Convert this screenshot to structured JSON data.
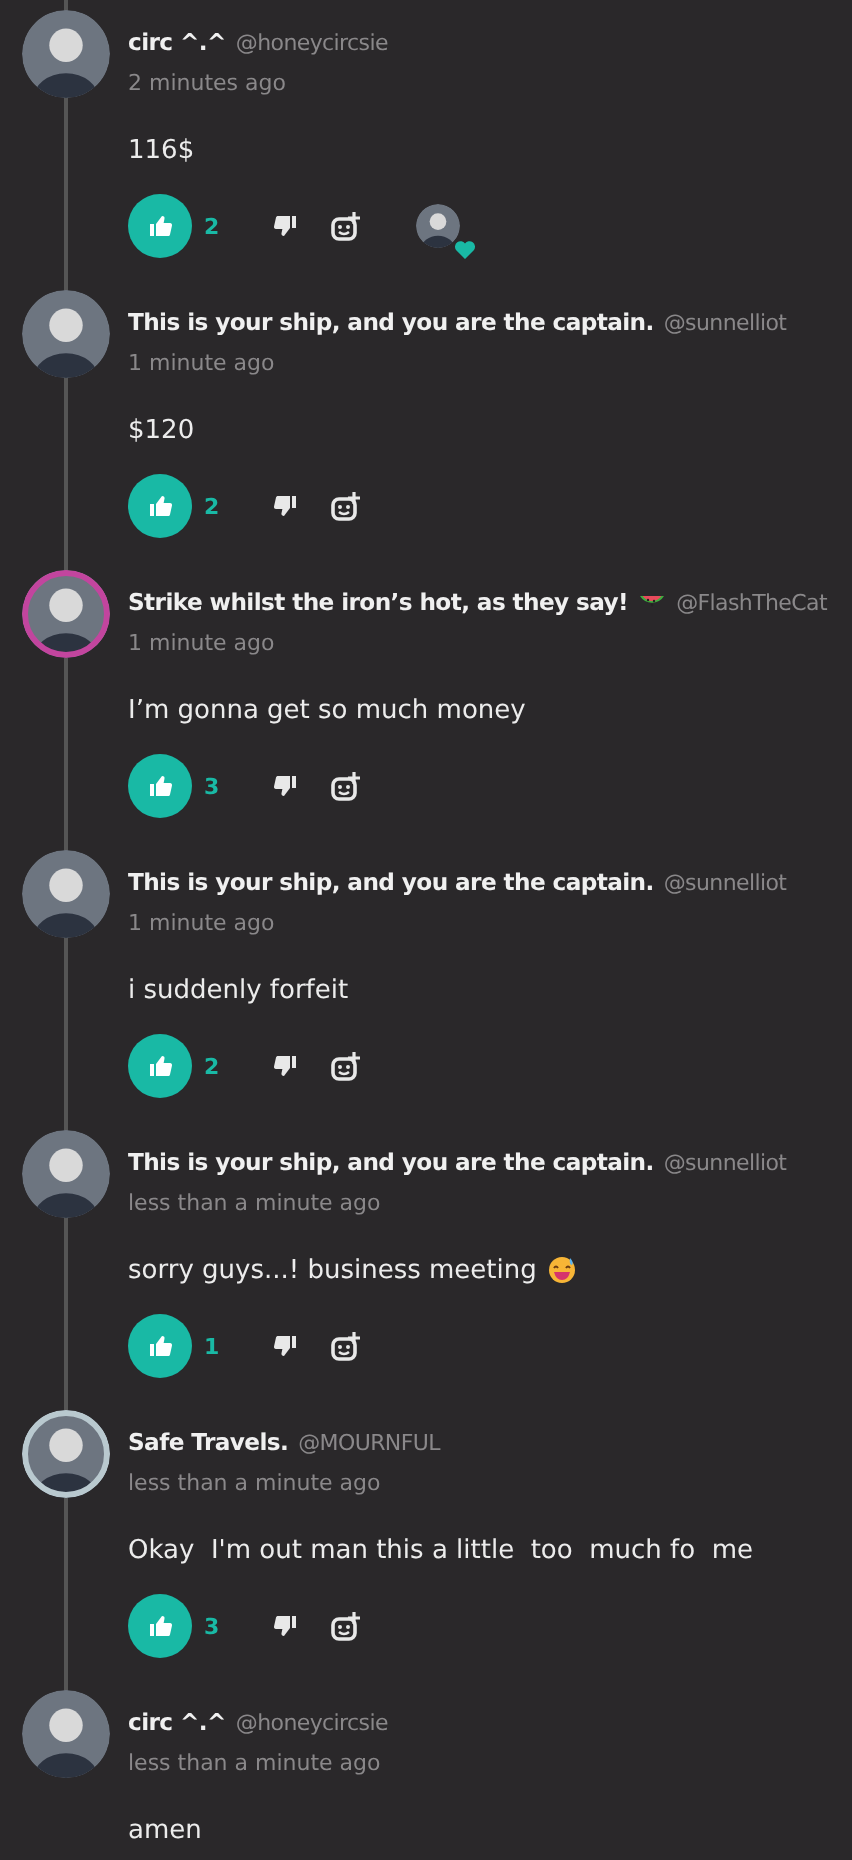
{
  "comments": [
    {
      "display_name": "circ ^.^",
      "handle": "@honeycircsie",
      "time": "2 minutes ago",
      "body": "116$",
      "liked": true,
      "like_count": "2",
      "reactions": [
        {
          "kind": "heart"
        }
      ]
    },
    {
      "display_name": "This is your ship, and you are the captain.",
      "handle": "@sunnelliot",
      "time": "1 minute ago",
      "body": "$120",
      "liked": true,
      "like_count": "2"
    },
    {
      "display_name": "Strike whilst the iron’s hot, as they say!",
      "name_emoji": {
        "kind": "watermelon"
      },
      "avatar_ring": {
        "color": "#c2459e"
      },
      "handle": "@FlashTheCat",
      "time": "1 minute ago",
      "body": "I’m gonna get so much money",
      "liked": true,
      "like_count": "3"
    },
    {
      "display_name": "This is your ship, and you are the captain.",
      "handle": "@sunnelliot",
      "time": "1 minute ago",
      "body": "i suddenly forfeit",
      "liked": true,
      "like_count": "2"
    },
    {
      "display_name": "This is your ship, and you are the captain.",
      "handle": "@sunnelliot",
      "time": "less than a minute ago",
      "body": "sorry guys...! business meeting",
      "body_emoji": {
        "kind": "grin-sweat"
      },
      "liked": true,
      "like_count": "1"
    },
    {
      "display_name": "Safe Travels.",
      "avatar_ring": {
        "color": "#b9c9cf"
      },
      "handle": "@MOURNFUL",
      "time": "less than a minute ago",
      "body": "Okay  I'm out man this a little  too  much fo  me",
      "liked": true,
      "like_count": "3"
    },
    {
      "display_name": "circ ^.^",
      "handle": "@honeycircsie",
      "time": "less than a minute ago",
      "body": "amen"
    }
  ]
}
